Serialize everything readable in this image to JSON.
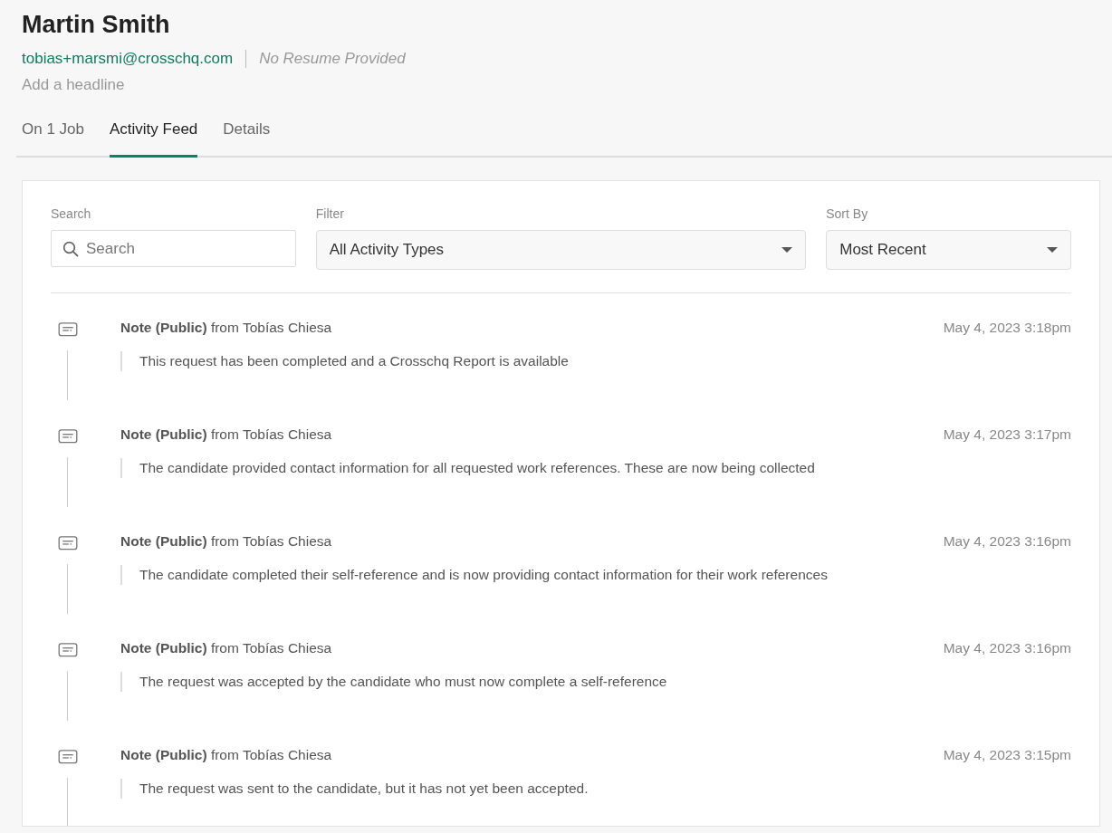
{
  "candidate": {
    "name": "Martin Smith",
    "email": "tobias+marsmi@crosschq.com",
    "resume": "No Resume Provided",
    "headline_placeholder": "Add a headline"
  },
  "tabs": [
    {
      "label": "On 1 Job",
      "selected": false
    },
    {
      "label": "Activity Feed",
      "selected": true
    },
    {
      "label": "Details",
      "selected": false
    }
  ],
  "filters": {
    "search": {
      "label": "Search",
      "placeholder": "Search"
    },
    "filter": {
      "label": "Filter",
      "value": "All Activity Types"
    },
    "sort": {
      "label": "Sort By",
      "value": "Most Recent"
    }
  },
  "activities": [
    {
      "title": "**Note (Public)** from Tobías Chiesa",
      "time": "May 4, 2023 3:18pm",
      "text": "This request has been completed and a Crosschq Report is available"
    },
    {
      "title": "**Note (Public)** from Tobías Chiesa",
      "time": "May 4, 2023 3:17pm",
      "text": "The candidate provided contact information for all requested work references. These are now being collected"
    },
    {
      "title": "**Note (Public)** from Tobías Chiesa",
      "time": "May 4, 2023 3:16pm",
      "text": "The candidate completed their self-reference and is now providing contact information for their work references"
    },
    {
      "title": "**Note (Public)** from Tobías Chiesa",
      "time": "May 4, 2023 3:16pm",
      "text": "The request was accepted by the candidate who must now complete a self-reference"
    },
    {
      "title": "**Note (Public)** from Tobías Chiesa",
      "time": "May 4, 2023 3:15pm",
      "text": "The request was sent to the candidate, but it has not yet been accepted."
    }
  ]
}
